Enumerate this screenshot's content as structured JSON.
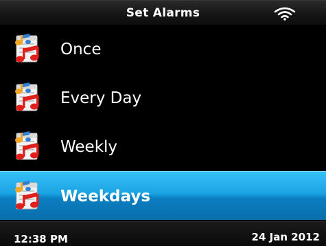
{
  "header": {
    "title": "Set Alarms",
    "status_icon": "wifi-icon"
  },
  "alarm_list": {
    "items": [
      {
        "label": "Once",
        "icon": "music-calendar-icon",
        "selected": false
      },
      {
        "label": "Every Day",
        "icon": "music-calendar-icon",
        "selected": false
      },
      {
        "label": "Weekly",
        "icon": "music-calendar-icon",
        "selected": false
      },
      {
        "label": "Weekdays",
        "icon": "music-calendar-icon",
        "selected": true
      }
    ]
  },
  "footer": {
    "time": "12:38 PM",
    "date": "24 Jan 2012"
  },
  "colors": {
    "background": "#000000",
    "selection": "#1aa3e2",
    "text": "#ffffff"
  }
}
